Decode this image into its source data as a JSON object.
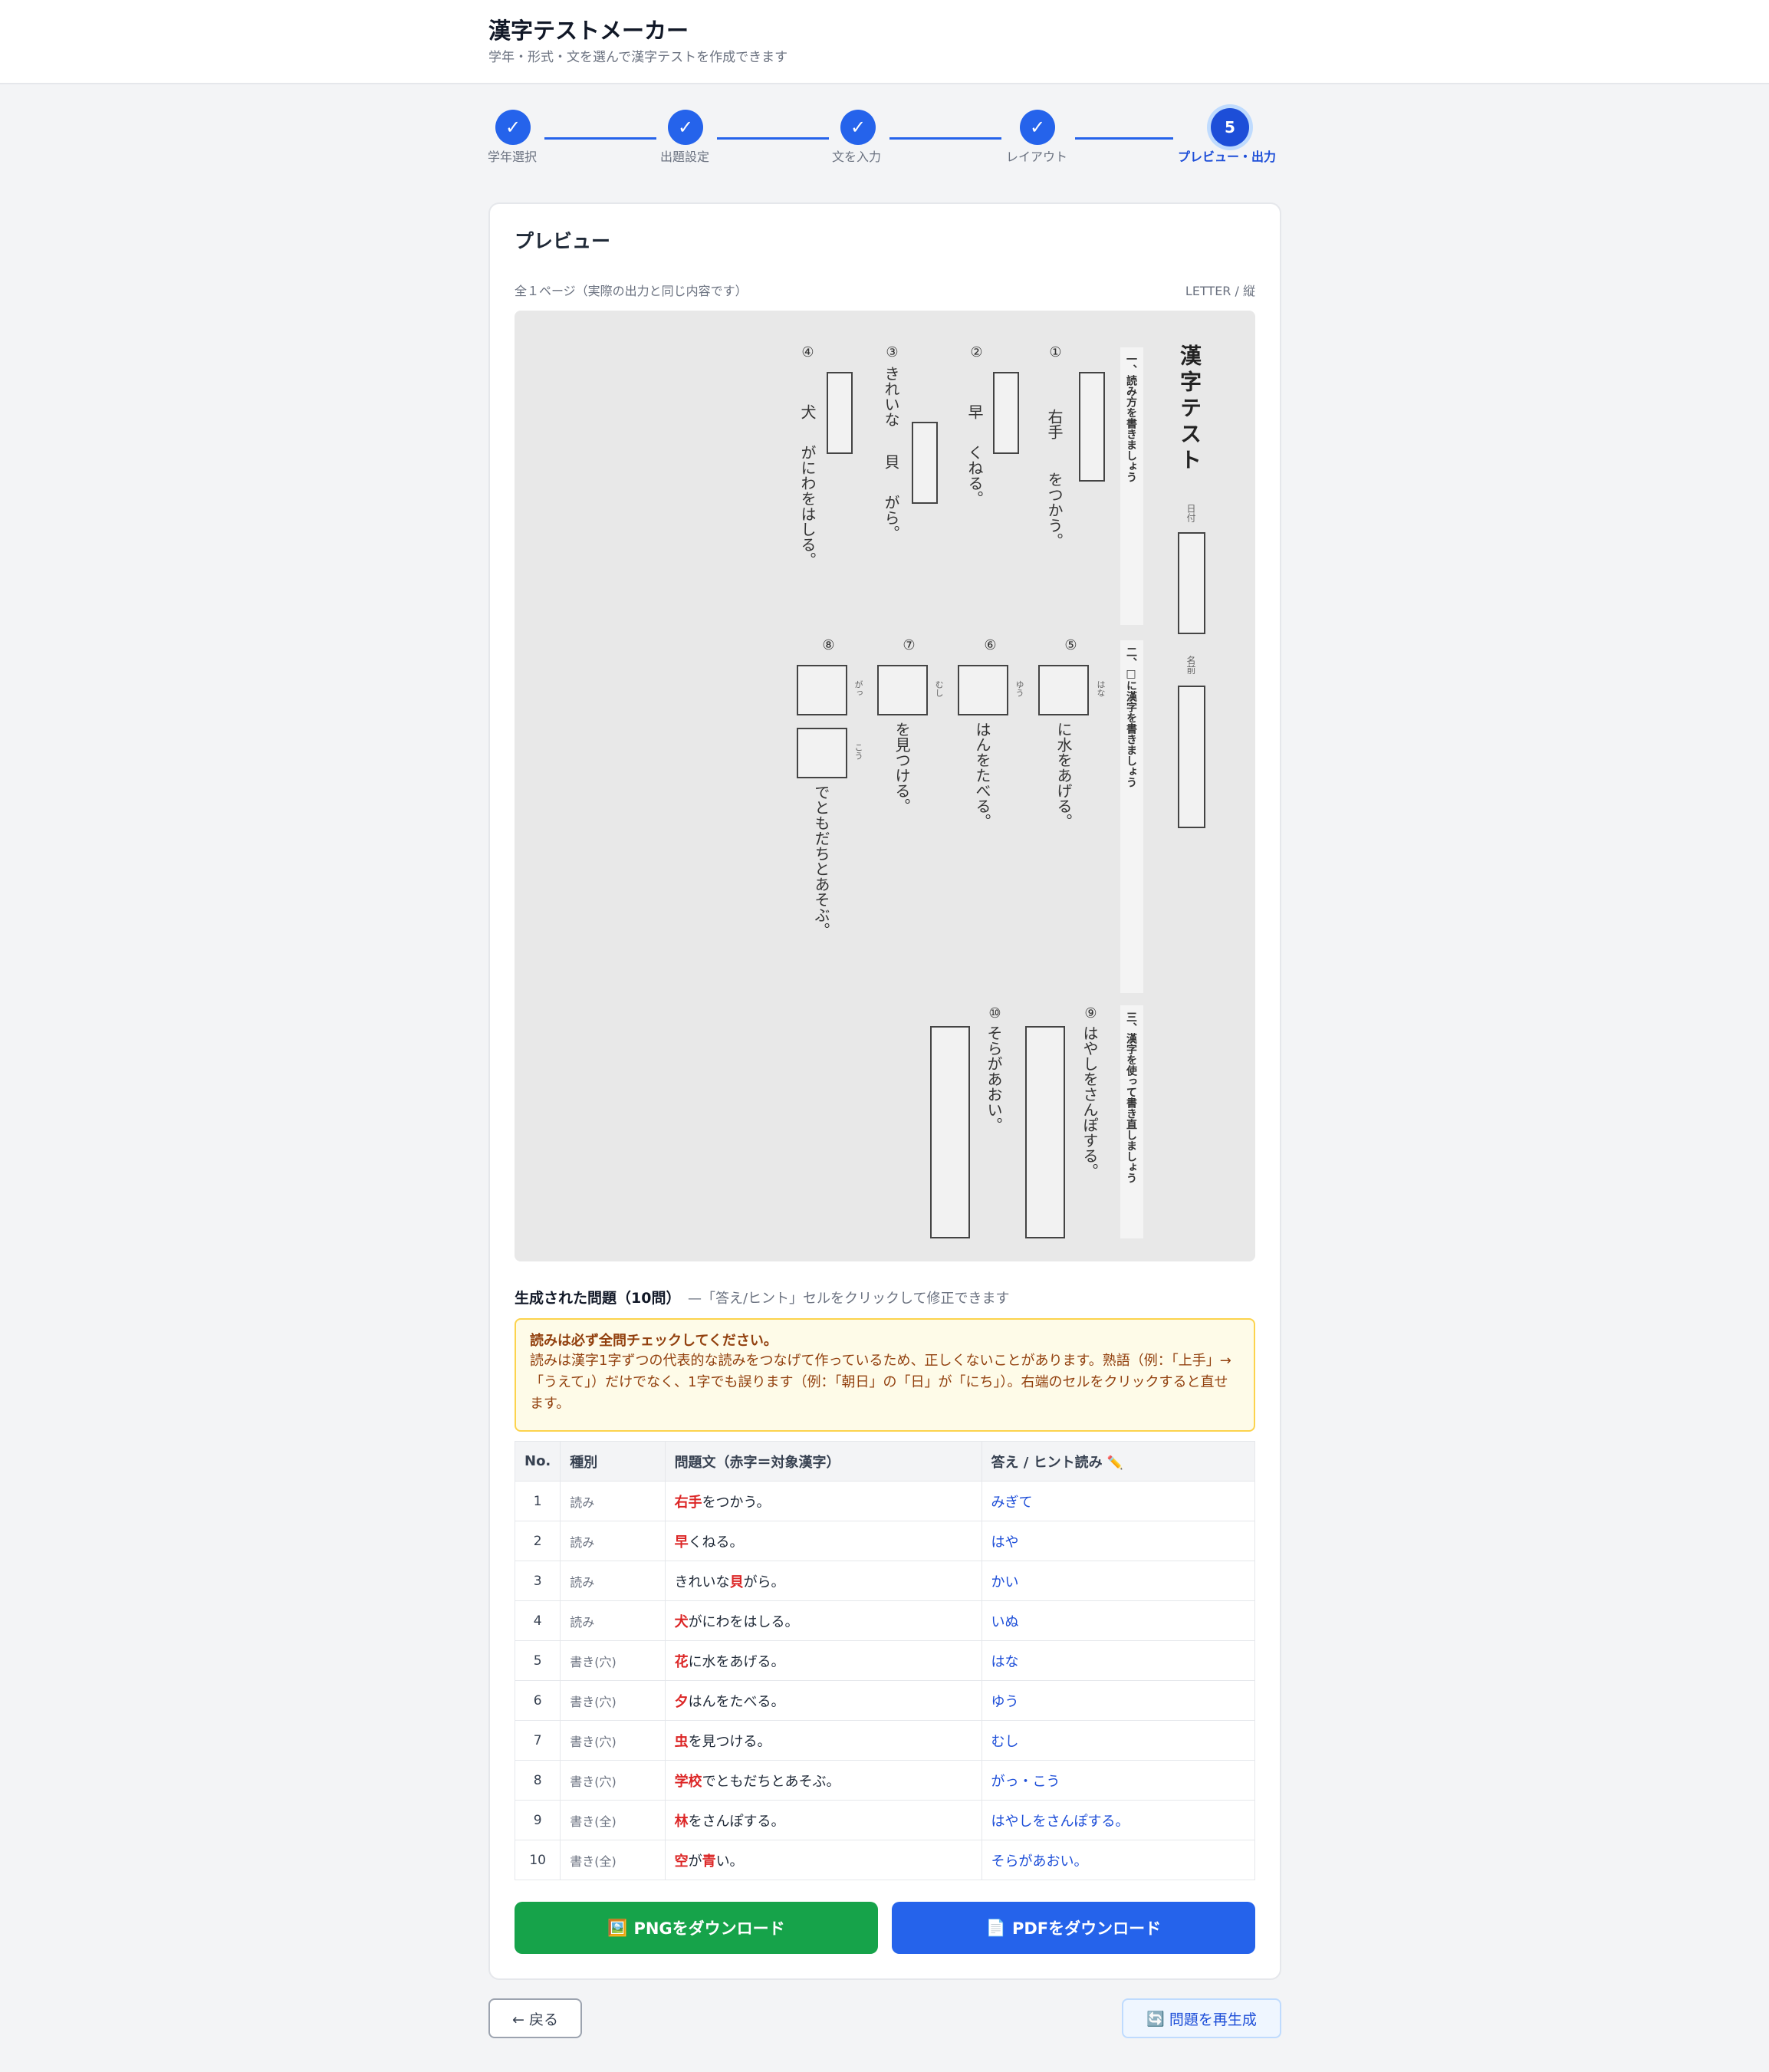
{
  "header": {
    "title": "漢字テストメーカー",
    "subtitle": "学年・形式・文を選んで漢字テストを作成できます"
  },
  "stepper": {
    "steps": [
      {
        "label": "学年選択",
        "mark": "✓",
        "state": "done"
      },
      {
        "label": "出題設定",
        "mark": "✓",
        "state": "done"
      },
      {
        "label": "文を入力",
        "mark": "✓",
        "state": "done"
      },
      {
        "label": "レイアウト",
        "mark": "✓",
        "state": "done"
      },
      {
        "label": "プレビュー・出力",
        "mark": "5",
        "state": "current"
      }
    ]
  },
  "preview": {
    "title": "プレビュー",
    "meta": "全１ページ（実際の出力と同じ内容です）",
    "paper": "LETTER / 縦"
  },
  "sheet": {
    "title": "漢字テスト",
    "date_label": "日付",
    "name_label": "名前",
    "sections": [
      "一、読み方を書きましょう",
      "二、□に漢字を書きましょう",
      "三、漢字を使って書き直しましょう"
    ],
    "q1": {
      "num": "①",
      "kanji": "右手",
      "rest": "をつかう。"
    },
    "q2": {
      "num": "②",
      "kanji": "早",
      "rest": "くねる。"
    },
    "q3": {
      "num": "③",
      "before": "きれいな",
      "kanji": "貝",
      "rest": "がら。"
    },
    "q4": {
      "num": "④",
      "kanji": "犬",
      "rest": "がにわをはしる。"
    },
    "q5": {
      "num": "⑤",
      "hint": "はな",
      "rest": "に水をあげる。"
    },
    "q6": {
      "num": "⑥",
      "hint": "ゆう",
      "rest": "はんをたべる。"
    },
    "q7": {
      "num": "⑦",
      "hint": "むし",
      "rest": "を見つける。"
    },
    "q8": {
      "num": "⑧",
      "hint1": "がっ",
      "hint2": "こう",
      "rest": "でともだちとあそぶ。"
    },
    "q9": {
      "num": "⑨",
      "text": "はやしをさんぽする。"
    },
    "q10": {
      "num": "⑩",
      "text": "そらがあおい。"
    }
  },
  "questions": {
    "heading": "生成された問題（10問）",
    "note": "—「答え/ヒント」セルをクリックして修正できます"
  },
  "warning": {
    "title": "読みは必ず全問チェックしてください。",
    "body": "読みは漢字1字ずつの代表的な読みをつなげて作っているため、正しくないことがあります。熟語（例：「上手」→「うえて」）だけでなく、1字でも誤ります（例：「朝日」の「日」が「にち」）。右端のセルをクリックすると直せます。"
  },
  "table": {
    "headers": [
      "No.",
      "種別",
      "問題文（赤字＝対象漢字）",
      "答え / ヒント読み"
    ],
    "edit_icon": "✏️",
    "rows": [
      {
        "no": "1",
        "type": "読み",
        "parts": [
          {
            "t": "右手",
            "k": true
          },
          {
            "t": "をつかう。",
            "k": false
          }
        ],
        "answer": "みぎて"
      },
      {
        "no": "2",
        "type": "読み",
        "parts": [
          {
            "t": "早",
            "k": true
          },
          {
            "t": "くねる。",
            "k": false
          }
        ],
        "answer": "はや"
      },
      {
        "no": "3",
        "type": "読み",
        "parts": [
          {
            "t": "きれいな",
            "k": false
          },
          {
            "t": "貝",
            "k": true
          },
          {
            "t": "がら。",
            "k": false
          }
        ],
        "answer": "かい"
      },
      {
        "no": "4",
        "type": "読み",
        "parts": [
          {
            "t": "犬",
            "k": true
          },
          {
            "t": "がにわをはしる。",
            "k": false
          }
        ],
        "answer": "いぬ"
      },
      {
        "no": "5",
        "type": "書き(穴)",
        "parts": [
          {
            "t": "花",
            "k": true
          },
          {
            "t": "に水をあげる。",
            "k": false
          }
        ],
        "answer": "はな"
      },
      {
        "no": "6",
        "type": "書き(穴)",
        "parts": [
          {
            "t": "夕",
            "k": true
          },
          {
            "t": "はんをたべる。",
            "k": false
          }
        ],
        "answer": "ゆう"
      },
      {
        "no": "7",
        "type": "書き(穴)",
        "parts": [
          {
            "t": "虫",
            "k": true
          },
          {
            "t": "を見つける。",
            "k": false
          }
        ],
        "answer": "むし"
      },
      {
        "no": "8",
        "type": "書き(穴)",
        "parts": [
          {
            "t": "学校",
            "k": true
          },
          {
            "t": "でともだちとあそぶ。",
            "k": false
          }
        ],
        "answer": "がっ・こう"
      },
      {
        "no": "9",
        "type": "書き(全)",
        "parts": [
          {
            "t": "林",
            "k": true
          },
          {
            "t": "をさんぽする。",
            "k": false
          }
        ],
        "answer": "はやしをさんぽする。"
      },
      {
        "no": "10",
        "type": "書き(全)",
        "parts": [
          {
            "t": "空",
            "k": true
          },
          {
            "t": "が",
            "k": false
          },
          {
            "t": "青",
            "k": true
          },
          {
            "t": "い。",
            "k": false
          }
        ],
        "answer": "そらがあおい。"
      }
    ]
  },
  "buttons": {
    "png": "PNGをダウンロード",
    "png_icon": "🖼️",
    "pdf": "PDFをダウンロード",
    "pdf_icon": "📄",
    "back": "← 戻る",
    "regen": "問題を再生成",
    "regen_icon": "🔄"
  }
}
